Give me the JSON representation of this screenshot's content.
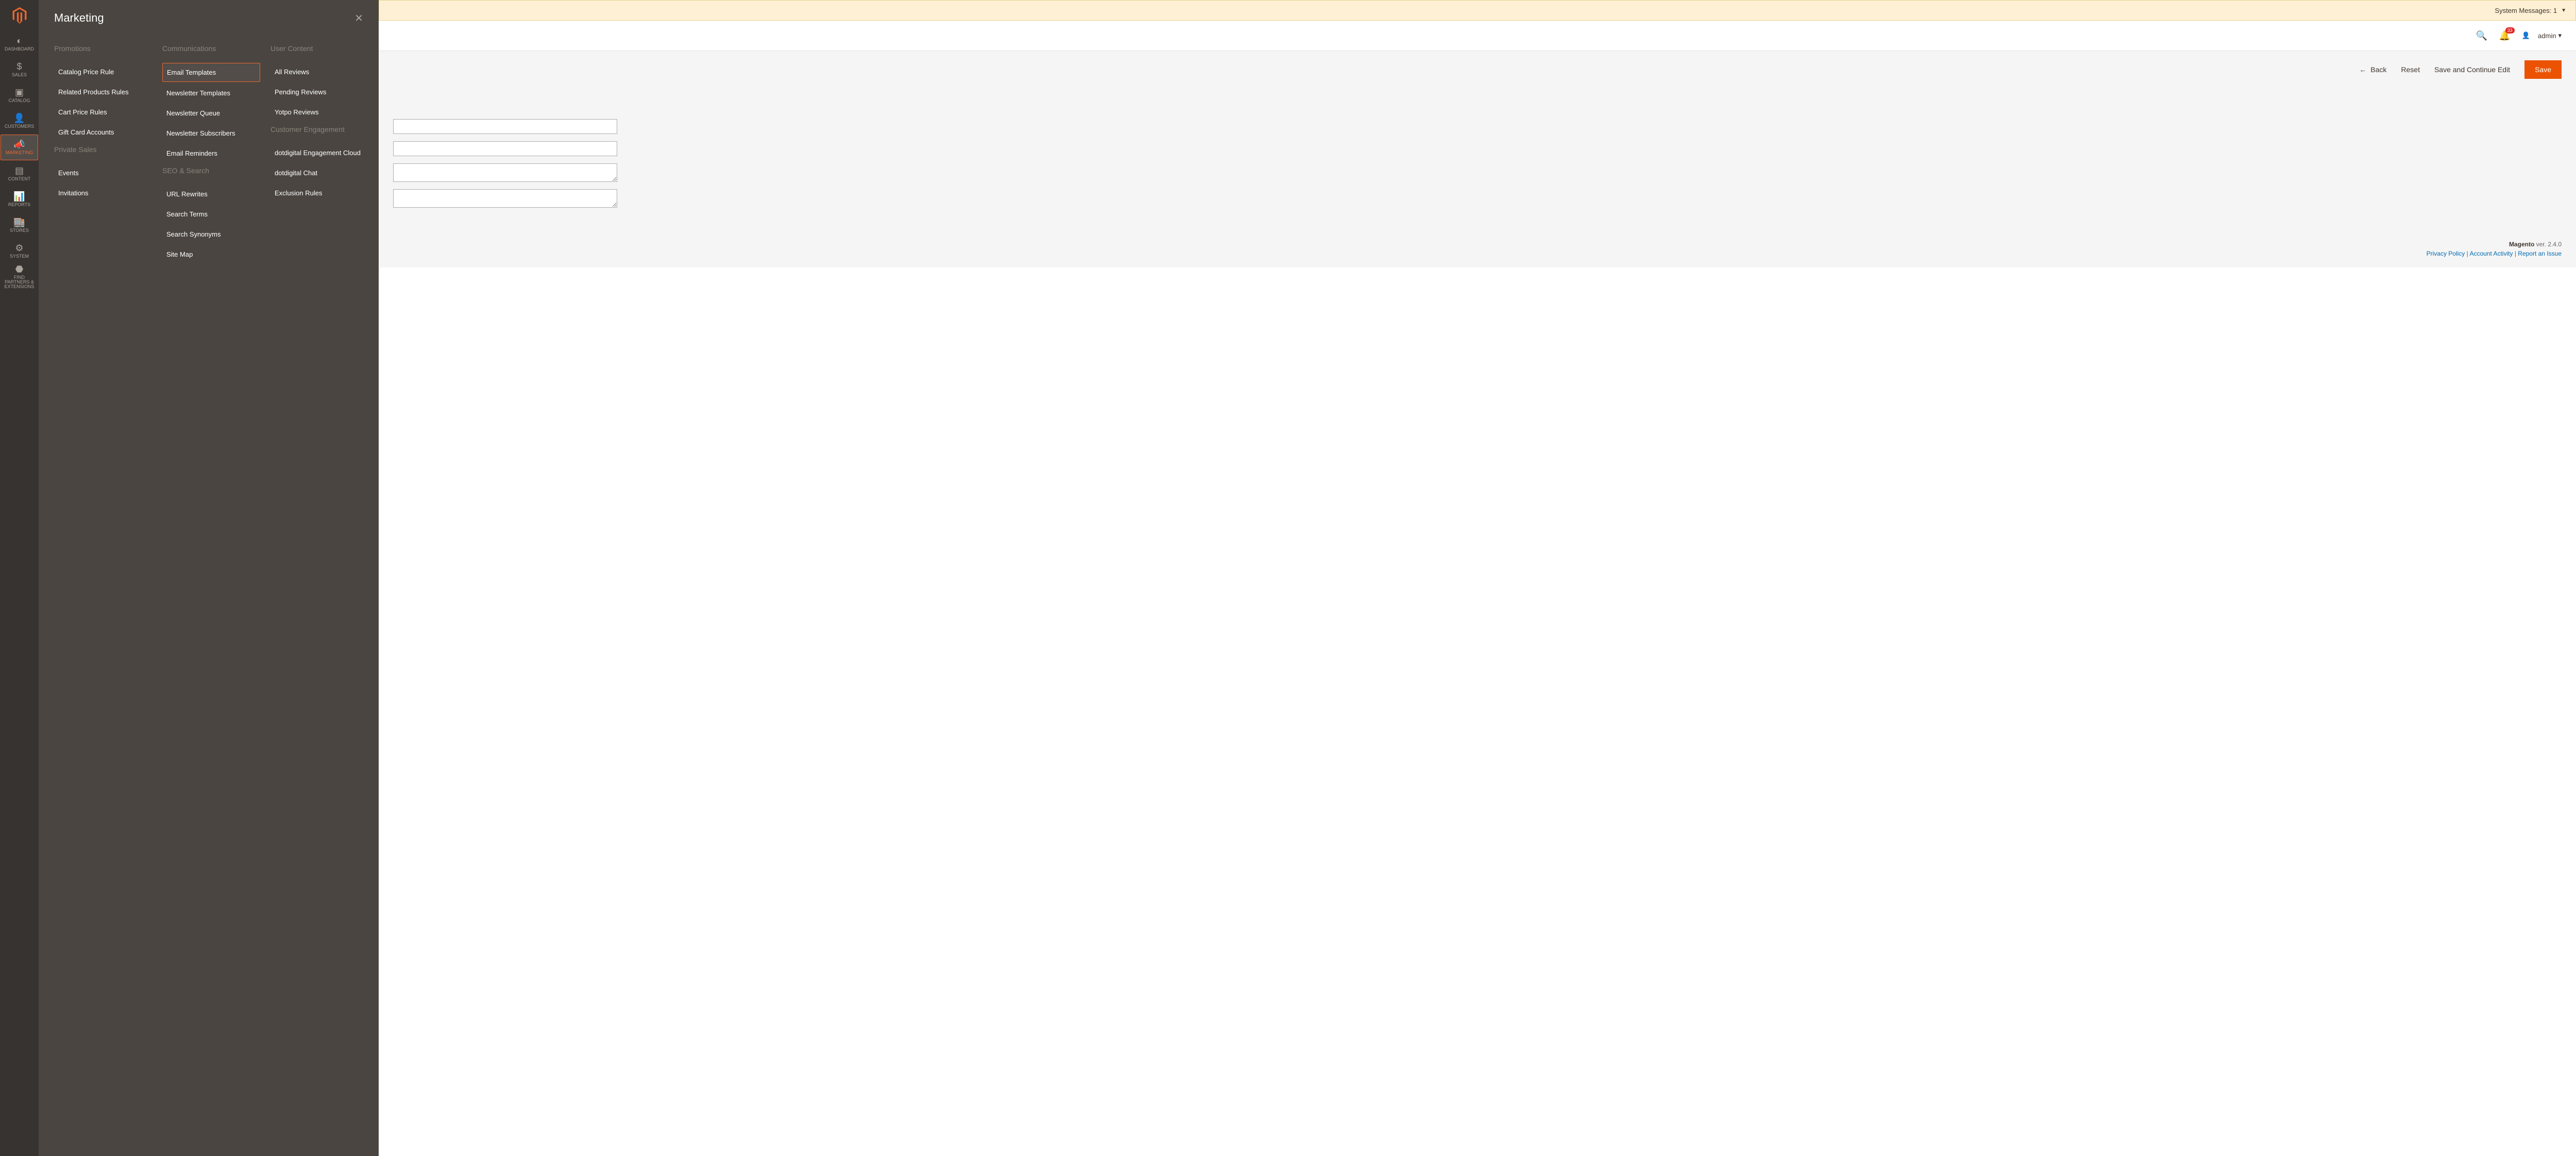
{
  "sidebar": {
    "items": [
      {
        "label": "DASHBOARD"
      },
      {
        "label": "SALES"
      },
      {
        "label": "CATALOG"
      },
      {
        "label": "CUSTOMERS"
      },
      {
        "label": "MARKETING"
      },
      {
        "label": "CONTENT"
      },
      {
        "label": "REPORTS"
      },
      {
        "label": "STORES"
      },
      {
        "label": "SYSTEM"
      },
      {
        "label": "FIND PARTNERS & EXTENSIONS"
      }
    ]
  },
  "flyout": {
    "title": "Marketing",
    "columns": [
      {
        "sections": [
          {
            "heading": "Promotions",
            "links": [
              "Catalog Price Rule",
              "Related Products Rules",
              "Cart Price Rules",
              "Gift Card Accounts"
            ]
          },
          {
            "heading": "Private Sales",
            "links": [
              "Events",
              "Invitations"
            ]
          }
        ]
      },
      {
        "sections": [
          {
            "heading": "Communications",
            "links": [
              "Email Templates",
              "Newsletter Templates",
              "Newsletter Queue",
              "Newsletter Subscribers",
              "Email Reminders"
            ]
          },
          {
            "heading": "SEO & Search",
            "links": [
              "URL Rewrites",
              "Search Terms",
              "Search Synonyms",
              "Site Map"
            ]
          }
        ]
      },
      {
        "sections": [
          {
            "heading": "User Content",
            "links": [
              "All Reviews",
              "Pending Reviews",
              "Yotpo Reviews"
            ]
          },
          {
            "heading": "Customer Engagement",
            "links": [
              "dotdigital Engagement Cloud",
              "dotdigital Chat",
              "Exclusion Rules"
            ]
          }
        ]
      }
    ],
    "highlighted_link": "Email Templates"
  },
  "system_messages": {
    "label": "System Messages:",
    "count": "1"
  },
  "header": {
    "notification_count": "33",
    "admin_label": "admin"
  },
  "toolbar": {
    "back": "Back",
    "reset": "Reset",
    "save_continue": "Save and Continue Edit",
    "save": "Save"
  },
  "footer": {
    "brand": "Magento",
    "version": "ver. 2.4.0",
    "links": [
      "Privacy Policy",
      "Account Activity",
      "Report an Issue"
    ]
  }
}
